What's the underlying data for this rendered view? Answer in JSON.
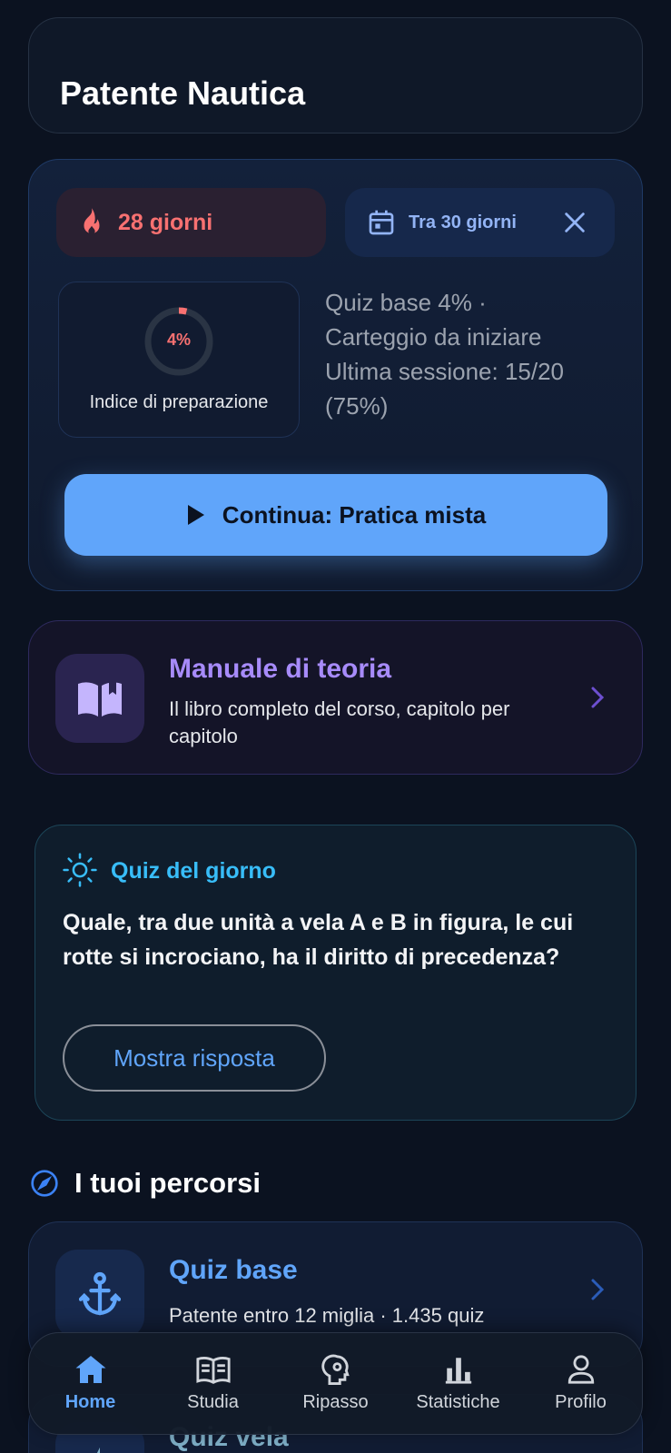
{
  "header": {
    "title": "Patente Nautica"
  },
  "progress_card": {
    "streak_label": "28 giorni",
    "exam_label": "Tra 30 giorni",
    "readiness_pct_label": "4%",
    "readiness_value": 0.04,
    "readiness_label": "Indice di preparazione",
    "stats_line1": "Quiz base 4% ·",
    "stats_line2": "Carteggio da iniziare",
    "stats_line3": "Ultima sessione: 15/20",
    "stats_line4": "(75%)",
    "continue_label": "Continua: Pratica mista",
    "colors": {
      "accent": "#60a5fa",
      "streak": "#f87171"
    }
  },
  "manual_card": {
    "title": "Manuale di teoria",
    "subtitle": "Il libro completo del corso, capitolo per capitolo",
    "color": "#a78bfa"
  },
  "daily_quiz": {
    "title": "Quiz del giorno",
    "question": "Quale, tra due unità a vela A e B in figura, le cui rotte si incrociano, ha il diritto di precedenza?",
    "answer_button": "Mostra risposta",
    "color": "#38bdf8"
  },
  "paths_section": {
    "title": "I tuoi percorsi",
    "items": [
      {
        "title": "Quiz base",
        "subtitle": "Patente entro 12 miglia · 1.435 quiz",
        "icon": "anchor-icon"
      },
      {
        "title": "Quiz vela",
        "icon": "sailboat-icon"
      }
    ]
  },
  "bottom_nav": {
    "items": [
      {
        "label": "Home",
        "icon": "home-icon",
        "active": true
      },
      {
        "label": "Studia",
        "icon": "book-icon"
      },
      {
        "label": "Ripasso",
        "icon": "brain-icon"
      },
      {
        "label": "Statistiche",
        "icon": "bar-chart-icon"
      },
      {
        "label": "Profilo",
        "icon": "person-icon"
      }
    ]
  }
}
